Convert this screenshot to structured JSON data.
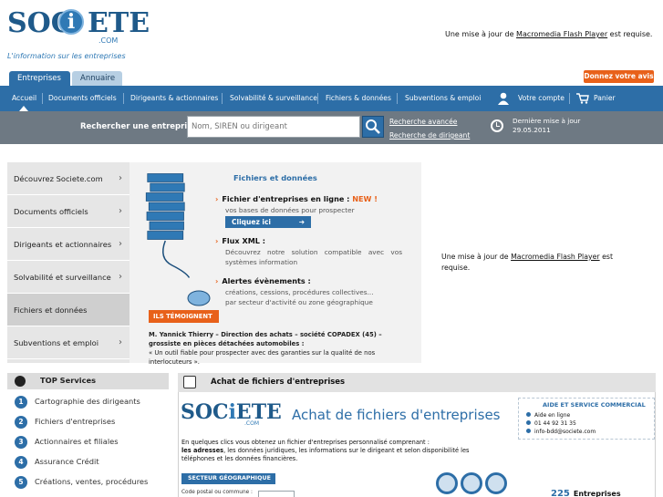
{
  "header": {
    "logo_word_left": "SOC",
    "logo_word_i": "i",
    "logo_word_right": "ETE",
    "logo_com": ".COM",
    "tagline": "L'information sur les entreprises",
    "flash_text_before": "Une mise à jour de ",
    "flash_link": "Macromedia Flash Player",
    "flash_text_after": " est requise."
  },
  "tabs": [
    {
      "label": "Entreprises"
    },
    {
      "label": "Annuaire"
    }
  ],
  "donnez_avis": "Donnez votre avis !",
  "nav": {
    "items": [
      {
        "label": "Accueil"
      },
      {
        "label": "Documents officiels"
      },
      {
        "label": "Dirigeants & actionnaires"
      },
      {
        "label": "Solvabilité & surveillance"
      },
      {
        "label": "Fichiers & données"
      },
      {
        "label": "Subventions & emploi"
      }
    ],
    "account": "Votre compte",
    "cart": "Panier"
  },
  "search": {
    "label": "Rechercher une entreprise",
    "placeholder": "Nom, SIREN ou dirigeant",
    "advanced": "Recherche avancée",
    "by_director": "Recherche de dirigeant",
    "update_line1": "Dernière mise à jour",
    "update_line2": "29.05.2011"
  },
  "menu": {
    "items": [
      {
        "label": "Découvrez Societe.com"
      },
      {
        "label": "Documents officiels"
      },
      {
        "label": "Dirigeants et actionnaires"
      },
      {
        "label": "Solvabilité et surveillance"
      },
      {
        "label": "Fichiers et données"
      },
      {
        "label": "Subventions et emploi"
      }
    ]
  },
  "banner": {
    "title": "Fichiers et données",
    "item1_title": "Fichier d'entreprises en ligne",
    "item1_new": "NEW !",
    "item1_sub": "vos bases de données pour prospecter",
    "cliquez": "Cliquez ici",
    "item2_title": "Flux XML :",
    "item2_sub": "Découvrez notre solution compatible avec vos systèmes information",
    "item3_title": "Alertes évènements :",
    "item3_sub1": "créations, cessions, procédures collectives...",
    "item3_sub2": "par secteur d'activité ou zone géographique",
    "temoignage": "ILS TÉMOIGNENT",
    "quote_author": "M. Yannick Thierry – Direction des achats – société COPADEX (45) – grossiste en pièces détachées automobiles :",
    "quote_text": "« Un outil fiable pour prospecter avec des garanties sur la qualité de nos interlocuteurs »."
  },
  "flash_mid": {
    "before": "Une mise à jour de ",
    "link": "Macromedia Flash Player",
    "after": " est requise."
  },
  "top_services": {
    "title": "TOP Services",
    "items": [
      {
        "num": "1",
        "label": "Cartographie des dirigeants"
      },
      {
        "num": "2",
        "label": "Fichiers d'entreprises"
      },
      {
        "num": "3",
        "label": "Actionnaires et filiales"
      },
      {
        "num": "4",
        "label": "Assurance Crédit"
      },
      {
        "num": "5",
        "label": "Créations, ventes, procédures"
      }
    ]
  },
  "achat": {
    "header": "Achat de fichiers d'entreprises",
    "title": "Achat de fichiers d'entreprises",
    "aide_title": "AIDE ET SERVICE COMMERCIAL",
    "aide_1": "Aide en ligne",
    "aide_2": "01 44 92 31 35",
    "aide_3": "info-bdd@societe.com",
    "text1": "En quelques clics vous obtenez un fichier d'entreprises personnalisé comprenant :",
    "text2_bold": "les adresses",
    "text2_rest": ", les données juridiques, les informations sur le dirigeant et selon disponibilité les téléphones et les données financières.",
    "secteur": "SECTEUR GÉOGRAPHIQUE",
    "cp": "Code postal ou commune :",
    "count_number": "225",
    "count_label": "Entreprises"
  },
  "colors": {
    "brand_blue": "#2d6ea7",
    "accent_orange": "#e8611a",
    "search_bar": "#6e7983"
  }
}
